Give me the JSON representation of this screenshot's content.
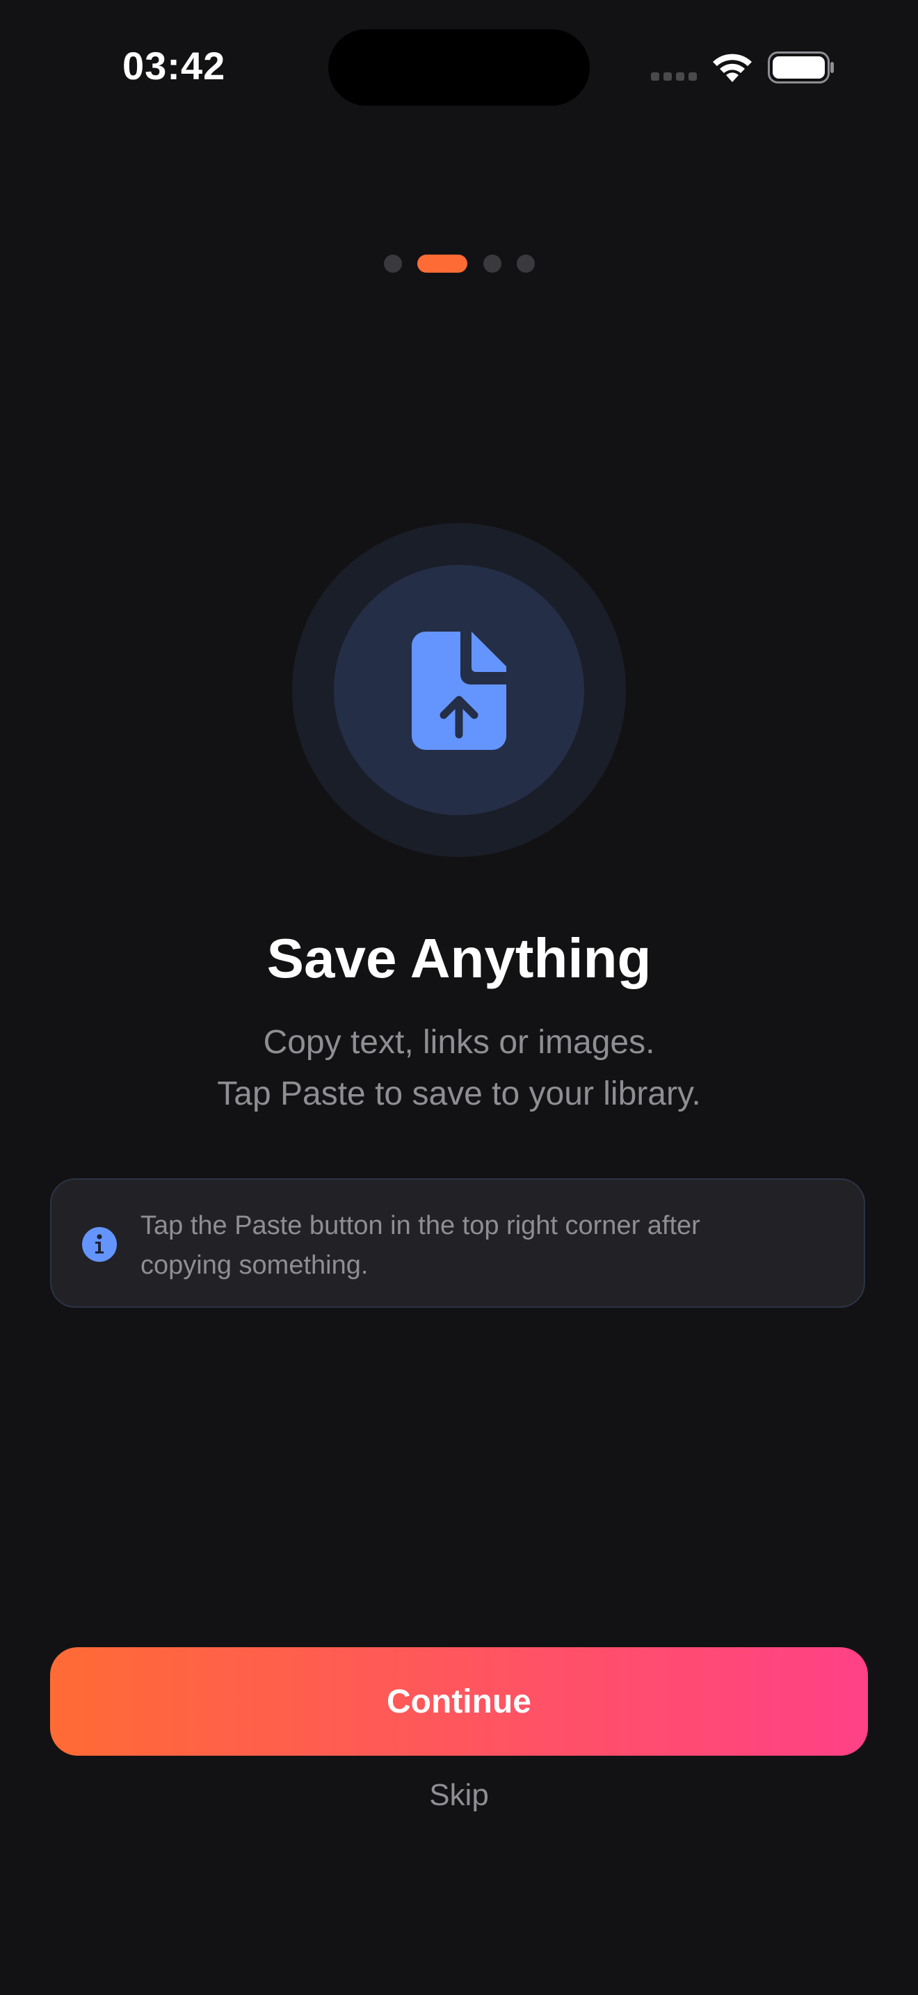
{
  "status_bar": {
    "time": "03:42",
    "signal_icon": "cellular-signal-icon",
    "wifi_icon": "wifi-icon",
    "battery_icon": "battery-icon"
  },
  "pager": {
    "page_count": 4,
    "current_page": 2
  },
  "hero": {
    "icon": "document-upload-icon",
    "icon_color": "#6495ff"
  },
  "content": {
    "title": "Save Anything",
    "subtitle_line1": "Copy text, links or images.",
    "subtitle_line2": "Tap Paste to save to your library."
  },
  "info_box": {
    "icon": "info-icon",
    "text_line1": "Tap the Paste button in the top right corner after",
    "text_line2": "copying something."
  },
  "actions": {
    "continue_label": "Continue",
    "skip_label": "Skip"
  },
  "colors": {
    "background": "#121214",
    "accent": "#ff6b35",
    "accent_end": "#ff4186",
    "icon_blue": "#6495ff",
    "secondary_text": "#8e8e93"
  }
}
